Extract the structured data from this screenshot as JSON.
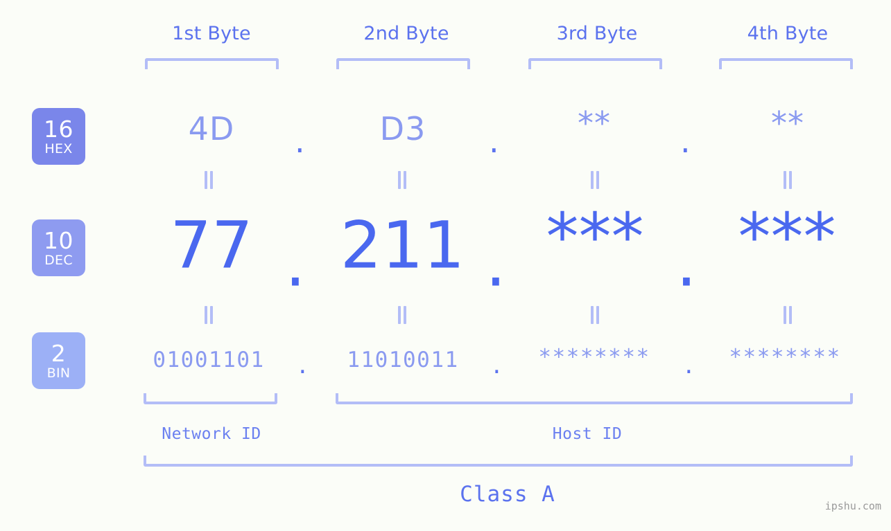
{
  "headers": [
    {
      "label": "1st Byte"
    },
    {
      "label": "2nd Byte"
    },
    {
      "label": "3rd Byte"
    },
    {
      "label": "4th Byte"
    }
  ],
  "bases": [
    {
      "num": "16",
      "abbr": "HEX"
    },
    {
      "num": "10",
      "abbr": "DEC"
    },
    {
      "num": "2",
      "abbr": "BIN"
    }
  ],
  "rows": {
    "hex": {
      "values": [
        "4D",
        "D3",
        "**",
        "**"
      ],
      "separator": "."
    },
    "dec": {
      "values": [
        "77",
        "211",
        "***",
        "***"
      ],
      "separator": "."
    },
    "bin": {
      "values": [
        "01001101",
        "11010011",
        "********",
        "********"
      ],
      "separator": "."
    }
  },
  "segments": {
    "network_id": "Network ID",
    "host_id": "Host ID"
  },
  "class_label": "Class A",
  "watermark": "ipshu.com",
  "colors": {
    "background": "#fbfdf8",
    "accent_strong": "#4a68ef",
    "accent_mid": "#5b72ee",
    "accent_light": "#8a9af0",
    "bracket": "#b3bdf7",
    "badge_hex": "#7a86ea",
    "badge_dec": "#8e9bf0",
    "badge_bin": "#9cb0f6",
    "watermark": "#9a9a9a"
  }
}
